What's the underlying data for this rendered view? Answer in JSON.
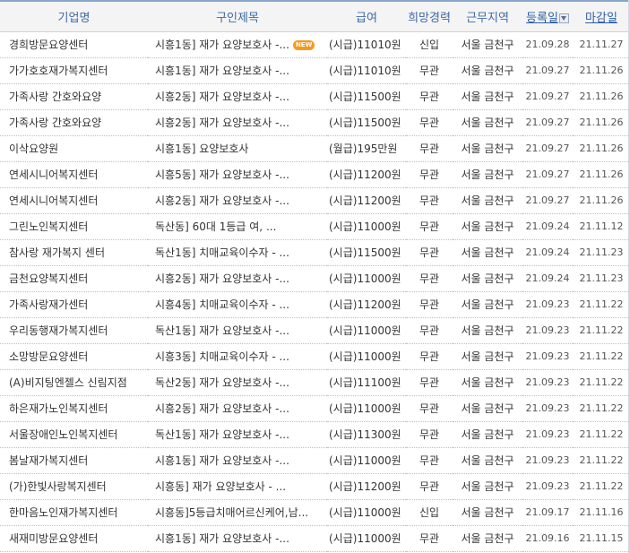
{
  "header": {
    "company": "기업명",
    "title": "구인제목",
    "pay": "급여",
    "experience": "희망경력",
    "region": "근무지역",
    "registered": "등록일",
    "deadline": "마감일"
  },
  "icons": {
    "sort": "sort-down-icon",
    "new": "new-badge"
  },
  "colors": {
    "header_text": "#3f6aa8",
    "new_badge": "#f49a1e"
  },
  "rows": [
    {
      "company": "경희방문요양센터",
      "title": "시흥1동] 재가 요양보호사 -...",
      "new": "NEW",
      "pay": "(시급)11010원",
      "exp": "신입",
      "region": "서울 금천구",
      "reg": "21.09.28",
      "deadline": "21.11.27"
    },
    {
      "company": "가가호호재가복지센터",
      "title": "시흥1동] 재가 요양보호사 -...",
      "new": "",
      "pay": "(시급)11010원",
      "exp": "무관",
      "region": "서울 금천구",
      "reg": "21.09.27",
      "deadline": "21.11.26"
    },
    {
      "company": "가족사랑 간호와요양",
      "title": "시흥2동] 재가 요양보호사 -...",
      "new": "",
      "pay": "(시급)11500원",
      "exp": "무관",
      "region": "서울 금천구",
      "reg": "21.09.27",
      "deadline": "21.11.26"
    },
    {
      "company": "가족사랑 간호와요양",
      "title": "시흥2동] 재가 요양보호사 -...",
      "new": "",
      "pay": "(시급)11500원",
      "exp": "무관",
      "region": "서울 금천구",
      "reg": "21.09.27",
      "deadline": "21.11.26"
    },
    {
      "company": "이삭요양원",
      "title": "시흥1동] 요양보호사",
      "new": "",
      "pay": "(월급)195만원",
      "exp": "무관",
      "region": "서울 금천구",
      "reg": "21.09.27",
      "deadline": "21.11.26"
    },
    {
      "company": "연세시니어복지센터",
      "title": "시흥5동] 재가 요양보호사 -...",
      "new": "",
      "pay": "(시급)11200원",
      "exp": "무관",
      "region": "서울 금천구",
      "reg": "21.09.27",
      "deadline": "21.11.26"
    },
    {
      "company": "연세시니어복지센터",
      "title": "시흥2동] 재가 요양보호사 -...",
      "new": "",
      "pay": "(시급)11200원",
      "exp": "무관",
      "region": "서울 금천구",
      "reg": "21.09.27",
      "deadline": "21.11.26"
    },
    {
      "company": "그린노인복지센터",
      "title": "독산동] 60대 1등급 여, ...",
      "new": "",
      "pay": "(시급)11000원",
      "exp": "무관",
      "region": "서울 금천구",
      "reg": "21.09.24",
      "deadline": "21.11.12"
    },
    {
      "company": "참사랑 재가복지 센터",
      "title": "독산1동] 치매교육이수자 - ...",
      "new": "",
      "pay": "(시급)11500원",
      "exp": "무관",
      "region": "서울 금천구",
      "reg": "21.09.24",
      "deadline": "21.11.23"
    },
    {
      "company": "금천요양복지센터",
      "title": "시흥2동] 재가 요양보호사 -...",
      "new": "",
      "pay": "(시급)11000원",
      "exp": "무관",
      "region": "서울 금천구",
      "reg": "21.09.24",
      "deadline": "21.11.23"
    },
    {
      "company": "가족사랑재가센터",
      "title": "시흥4동] 치매교육이수자 - ...",
      "new": "",
      "pay": "(시급)11200원",
      "exp": "무관",
      "region": "서울 금천구",
      "reg": "21.09.23",
      "deadline": "21.11.22"
    },
    {
      "company": "우리동행재가복지센터",
      "title": "독산1동] 재가 요양보호사 -...",
      "new": "",
      "pay": "(시급)11000원",
      "exp": "무관",
      "region": "서울 금천구",
      "reg": "21.09.23",
      "deadline": "21.11.22"
    },
    {
      "company": "소망방문요양센터",
      "title": "시흥3동] 치매교육이수자 - ...",
      "new": "",
      "pay": "(시급)11000원",
      "exp": "무관",
      "region": "서울 금천구",
      "reg": "21.09.23",
      "deadline": "21.11.22"
    },
    {
      "company": "(A)비지팅엔젤스 신림지점",
      "title": "독산2동] 재가 요양보호사 -...",
      "new": "",
      "pay": "(시급)11100원",
      "exp": "무관",
      "region": "서울 금천구",
      "reg": "21.09.23",
      "deadline": "21.11.22"
    },
    {
      "company": "하은재가노인복지센터",
      "title": "시흥2동] 재가 요양보호사 -...",
      "new": "",
      "pay": "(시급)11000원",
      "exp": "무관",
      "region": "서울 금천구",
      "reg": "21.09.23",
      "deadline": "21.11.22"
    },
    {
      "company": "서울장애인노인복지센터",
      "title": "독산1동] 재가 요양보호사 -...",
      "new": "",
      "pay": "(시급)11300원",
      "exp": "무관",
      "region": "서울 금천구",
      "reg": "21.09.23",
      "deadline": "21.11.22"
    },
    {
      "company": "봄날재가복지센터",
      "title": "시흥1동] 재가 요양보호사 -...",
      "new": "",
      "pay": "(시급)11000원",
      "exp": "무관",
      "region": "서울 금천구",
      "reg": "21.09.23",
      "deadline": "21.11.22"
    },
    {
      "company": "(가)한빛사랑복지센터",
      "title": "시흥동] 재가 요양보호사 - ...",
      "new": "",
      "pay": "(시급)11200원",
      "exp": "무관",
      "region": "서울 금천구",
      "reg": "21.09.23",
      "deadline": "21.11.22"
    },
    {
      "company": "한마음노인재가복지센터",
      "title": "시흥동]5등급치매어르신케어,남...",
      "new": "",
      "pay": "(시급)11000원",
      "exp": "신입",
      "region": "서울 금천구",
      "reg": "21.09.17",
      "deadline": "21.11.16"
    },
    {
      "company": "새재미방문요양센터",
      "title": "시흥1동] 재가 요양보호사 -...",
      "new": "",
      "pay": "(시급)11000원",
      "exp": "무관",
      "region": "서울 금천구",
      "reg": "21.09.16",
      "deadline": "21.11.15"
    }
  ]
}
